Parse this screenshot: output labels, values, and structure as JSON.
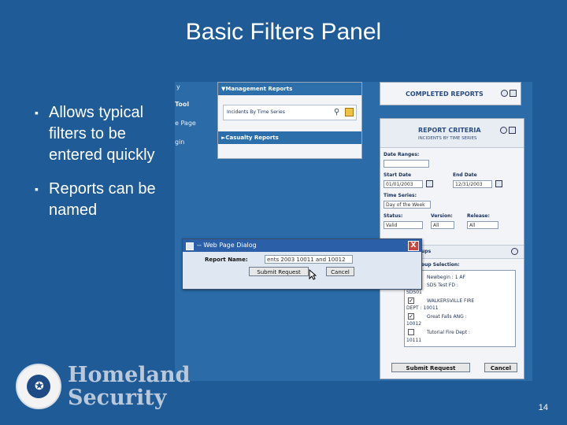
{
  "slide": {
    "title": "Basic Filters Panel",
    "bullets": [
      "Allows typical filters to be entered quickly",
      "Reports can be named"
    ],
    "page_number": "14",
    "logo_text_line1": "Homeland",
    "logo_text_line2": "Security"
  },
  "app": {
    "leftnav_fragments": [
      "y",
      "Tool",
      "e Page",
      "gin"
    ],
    "management_reports": "▼Management Reports",
    "report_item": "Incidents By Time Series",
    "casualty_reports": "►Casualty Reports",
    "completed_reports": "COMPLETED REPORTS",
    "criteria_title": "REPORT CRITERIA",
    "criteria_sub": "INCIDENTS BY TIME SERIES",
    "date_ranges": "Date Ranges:",
    "start_date_label": "Start Date",
    "start_date_value": "01/01/2003",
    "end_date_label": "End Date",
    "end_date_value": "12/31/2003",
    "time_series_label": "Time Series:",
    "time_series_value": "Day of the Week",
    "status_label": "Status:",
    "status_value": "Valid",
    "version_label": "Version:",
    "version_value": "All",
    "release_label": "Release:",
    "release_value": "All",
    "group_header": "ups",
    "group_selection_label": "oup Selection:",
    "groups": [
      "Newbegin : 1 AF",
      "SDS Test FD :",
      "SDS01",
      "WALKERSVILLE FIRE",
      "DEPT : 10011",
      "Great Falls ANG :",
      "10012",
      "Tutorial Fire Dept :",
      "10111"
    ],
    "submit_request": "Submit Request",
    "cancel": "Cancel"
  },
  "dialog": {
    "title": "-- Web Page Dialog",
    "close": "X",
    "report_name_label": "Report Name:",
    "report_name_value": "ents 2003 10011 and 10012",
    "submit_request": "Submit Request",
    "cancel": "Cancel"
  }
}
